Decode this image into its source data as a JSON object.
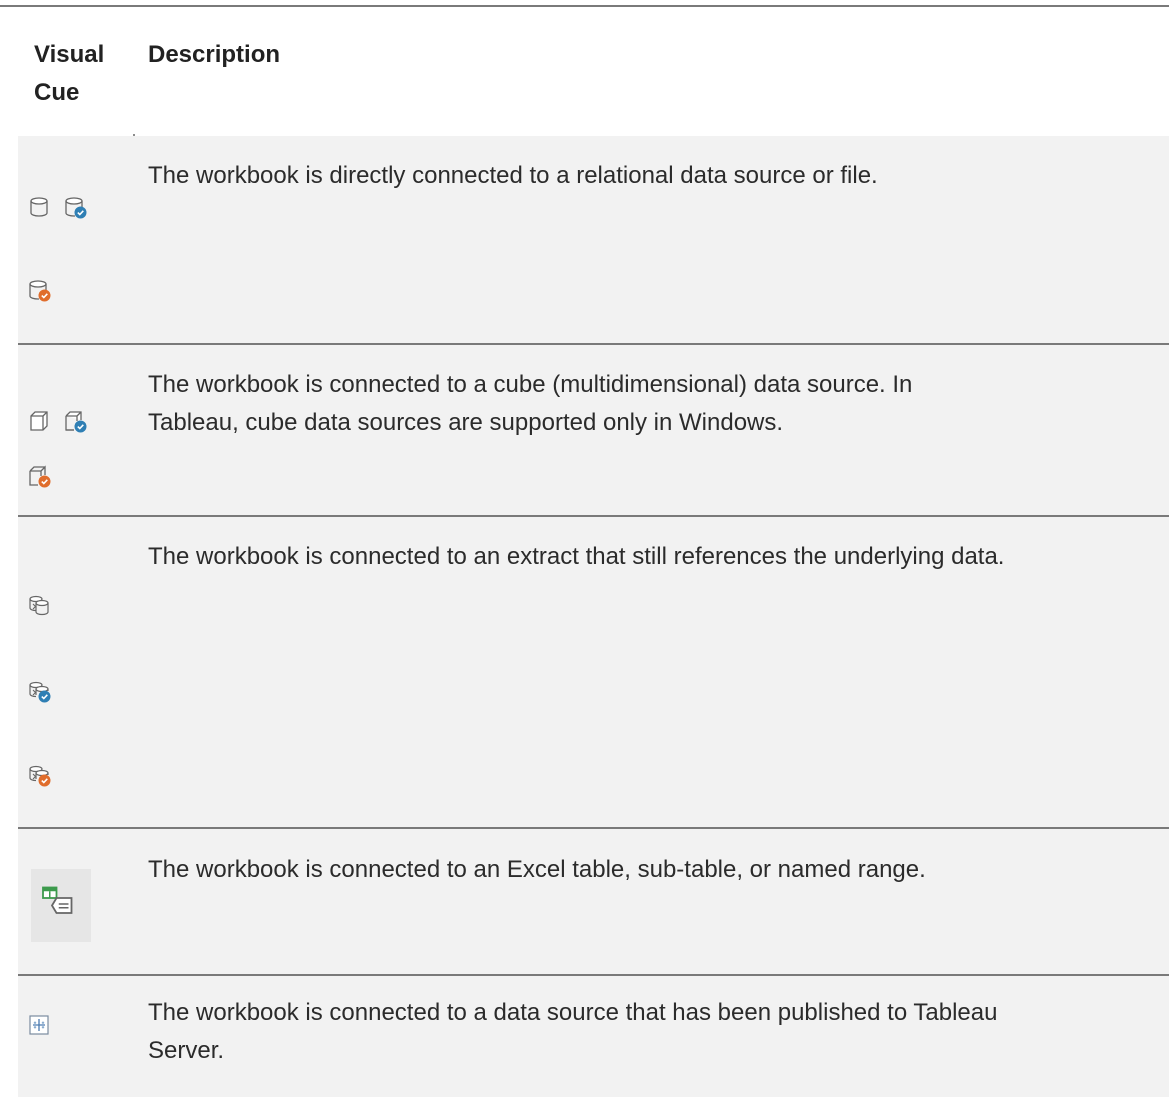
{
  "table": {
    "header": {
      "visual_cue": "Visual Cue",
      "visual_cue_line1": "Visual",
      "visual_cue_line2": "Cue",
      "description": "Description"
    },
    "rows": [
      {
        "icons": [
          "database-icon",
          "database-blue-check-icon",
          "database-orange-check-icon"
        ],
        "description": "The workbook is directly connected to a relational data source or file."
      },
      {
        "icons": [
          "cube-icon",
          "cube-blue-check-icon",
          "cube-orange-check-icon"
        ],
        "description_line1": "The workbook is connected to a cube (multidimensional) data source. In",
        "description_line2": "Tableau, cube data sources are supported only in Windows."
      },
      {
        "icons": [
          "extract-icon",
          "extract-blue-check-icon",
          "extract-orange-check-icon"
        ],
        "description": "The workbook is connected to an extract that still references the underlying data."
      },
      {
        "icons": [
          "excel-table-icon"
        ],
        "description": "The workbook is connected to an Excel table, sub-table, or named range."
      },
      {
        "icons": [
          "tableau-server-icon"
        ],
        "description_line1": "The workbook is connected to a data source that has been published to Tableau",
        "description_line2": "Server."
      }
    ]
  },
  "colors": {
    "blue_badge": "#2f7fb4",
    "orange_badge": "#e06d2c",
    "row_background": "#f2f2f2",
    "rule": "#7a7a7a"
  }
}
